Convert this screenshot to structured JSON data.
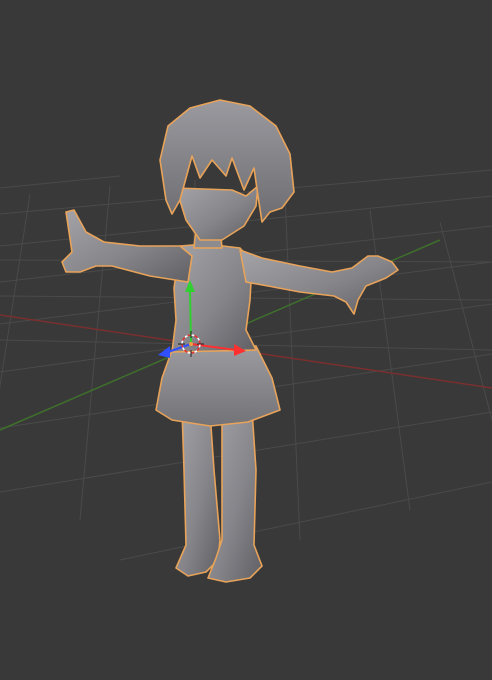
{
  "viewport": {
    "background": "#393939",
    "grid_color": "#4a4a4a",
    "x_axis_color": "#7a2f2f",
    "y_axis_color": "#3f6f2c",
    "selection_outline_color": "#e8a35a",
    "mesh_color": "#8a8a8e"
  },
  "object": {
    "selected": true,
    "shading": "solid"
  },
  "gizmo": {
    "x_color": "#ff3030",
    "y_color": "#30d030",
    "z_color": "#3050ff",
    "icons": [
      "translate-x-arrow-icon",
      "translate-y-arrow-icon",
      "translate-z-arrow-icon",
      "3d-cursor-icon"
    ]
  }
}
